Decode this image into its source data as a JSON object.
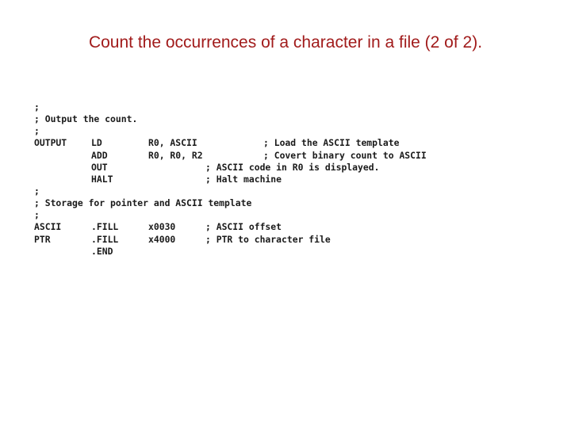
{
  "title": "Count the occurrences of a character in a file (2 of 2).",
  "code": {
    "lines": [
      {
        "label": ";",
        "op": "",
        "args": "",
        "cmt_near": "",
        "cmt_far": ""
      },
      {
        "label": "; Output the count.",
        "op": "",
        "args": "",
        "cmt_near": "",
        "cmt_far": ""
      },
      {
        "label": ";",
        "op": "",
        "args": "",
        "cmt_near": "",
        "cmt_far": ""
      },
      {
        "label": "OUTPUT",
        "op": "LD",
        "args": "R0, ASCII",
        "cmt_near": "",
        "cmt_far": "; Load the ASCII template"
      },
      {
        "label": "",
        "op": "ADD",
        "args": "R0, R0, R2",
        "cmt_near": "",
        "cmt_far": "; Covert binary count to ASCII"
      },
      {
        "label": "",
        "op": "OUT",
        "args": "",
        "cmt_near": "; ASCII code in R0 is displayed.",
        "cmt_far": ""
      },
      {
        "label": "",
        "op": "HALT",
        "args": "",
        "cmt_near": "; Halt machine",
        "cmt_far": ""
      },
      {
        "label": ";",
        "op": "",
        "args": "",
        "cmt_near": "",
        "cmt_far": ""
      },
      {
        "label": "; Storage for pointer and ASCII template",
        "op": "",
        "args": "",
        "cmt_near": "",
        "cmt_far": ""
      },
      {
        "label": ";",
        "op": "",
        "args": "",
        "cmt_near": "",
        "cmt_far": ""
      },
      {
        "label": "ASCII",
        "op": ".FILL",
        "args": "x0030",
        "cmt_near": "; ASCII offset",
        "cmt_far": ""
      },
      {
        "label": "PTR",
        "op": ".FILL",
        "args": "x4000",
        "cmt_near": "; PTR to character file",
        "cmt_far": ""
      },
      {
        "label": "",
        "op": ".END",
        "args": "",
        "cmt_near": "",
        "cmt_far": ""
      }
    ]
  }
}
